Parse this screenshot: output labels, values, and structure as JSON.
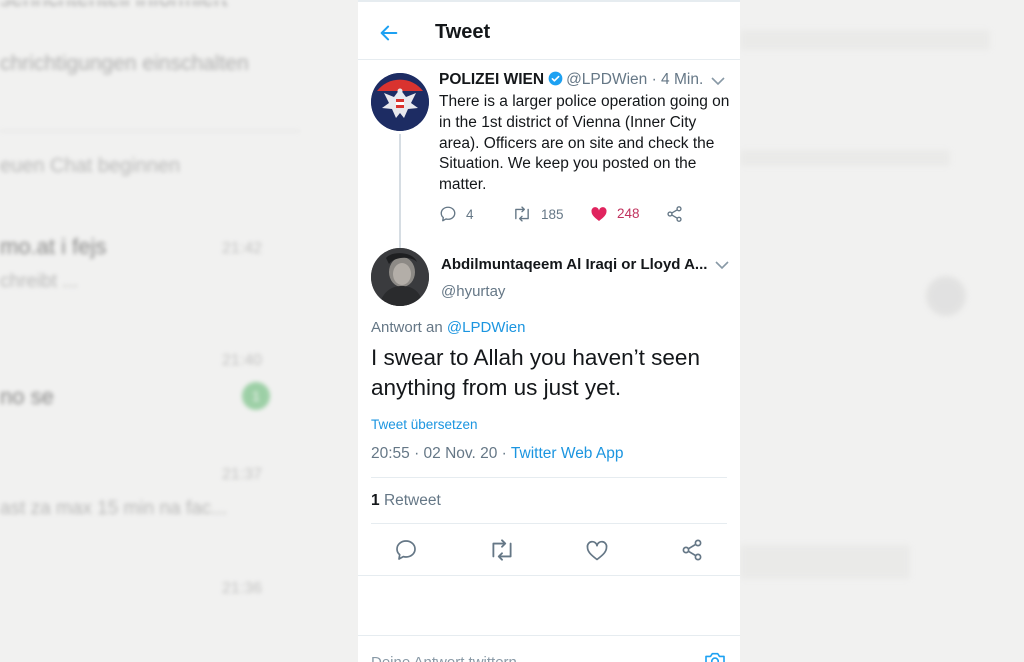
{
  "background_app": {
    "title": "sehrichtenteil informiert",
    "notifications_label": "chrichtigungen einschalten",
    "new_chat_label": "euen Chat beginnen",
    "chats": [
      {
        "name": "mo.at i fejs",
        "preview": "chreibt ...",
        "time": "21:42"
      },
      {
        "name": "no se",
        "preview": "",
        "time": "21:40",
        "badge": "1"
      },
      {
        "name": "",
        "preview": "",
        "time": "21:37"
      },
      {
        "name": "ast za max 15 min na fac...",
        "preview": "",
        "time": ""
      },
      {
        "name": "",
        "preview": "",
        "time": "21:36"
      }
    ]
  },
  "header": {
    "back_icon": "arrow-left-icon",
    "title": "Tweet"
  },
  "parent_tweet": {
    "name": "POLIZEI WIEN",
    "verified": true,
    "handle": "@LPDWien",
    "time_ago": "· 4 Min.",
    "text": "There is a larger police operation going on in the 1st district of Vienna (Inner City area). Officers are on site and check the Situation. We keep you posted on the matter.",
    "replies": "4",
    "retweets": "185",
    "likes": "248",
    "liked": true
  },
  "reply_tweet": {
    "name": "Abdilmuntaqeem Al Iraqi or Lloyd A...",
    "handle": "@hyurtay",
    "reply_prefix": "Antwort an",
    "reply_to": "@LPDWien",
    "text": "I swear to Allah you haven’t seen anything from us just yet.",
    "translate_label": "Tweet übersetzen",
    "timestamp": "20:55 · 02 Nov. 20 ·",
    "source": "Twitter Web App",
    "retweet_count": "1",
    "retweet_label": "Retweet"
  },
  "reply_box": {
    "placeholder": "Deine Antwort twittern"
  },
  "colors": {
    "link": "#1b95e0",
    "like": "#e0245e",
    "muted": "#657786"
  }
}
